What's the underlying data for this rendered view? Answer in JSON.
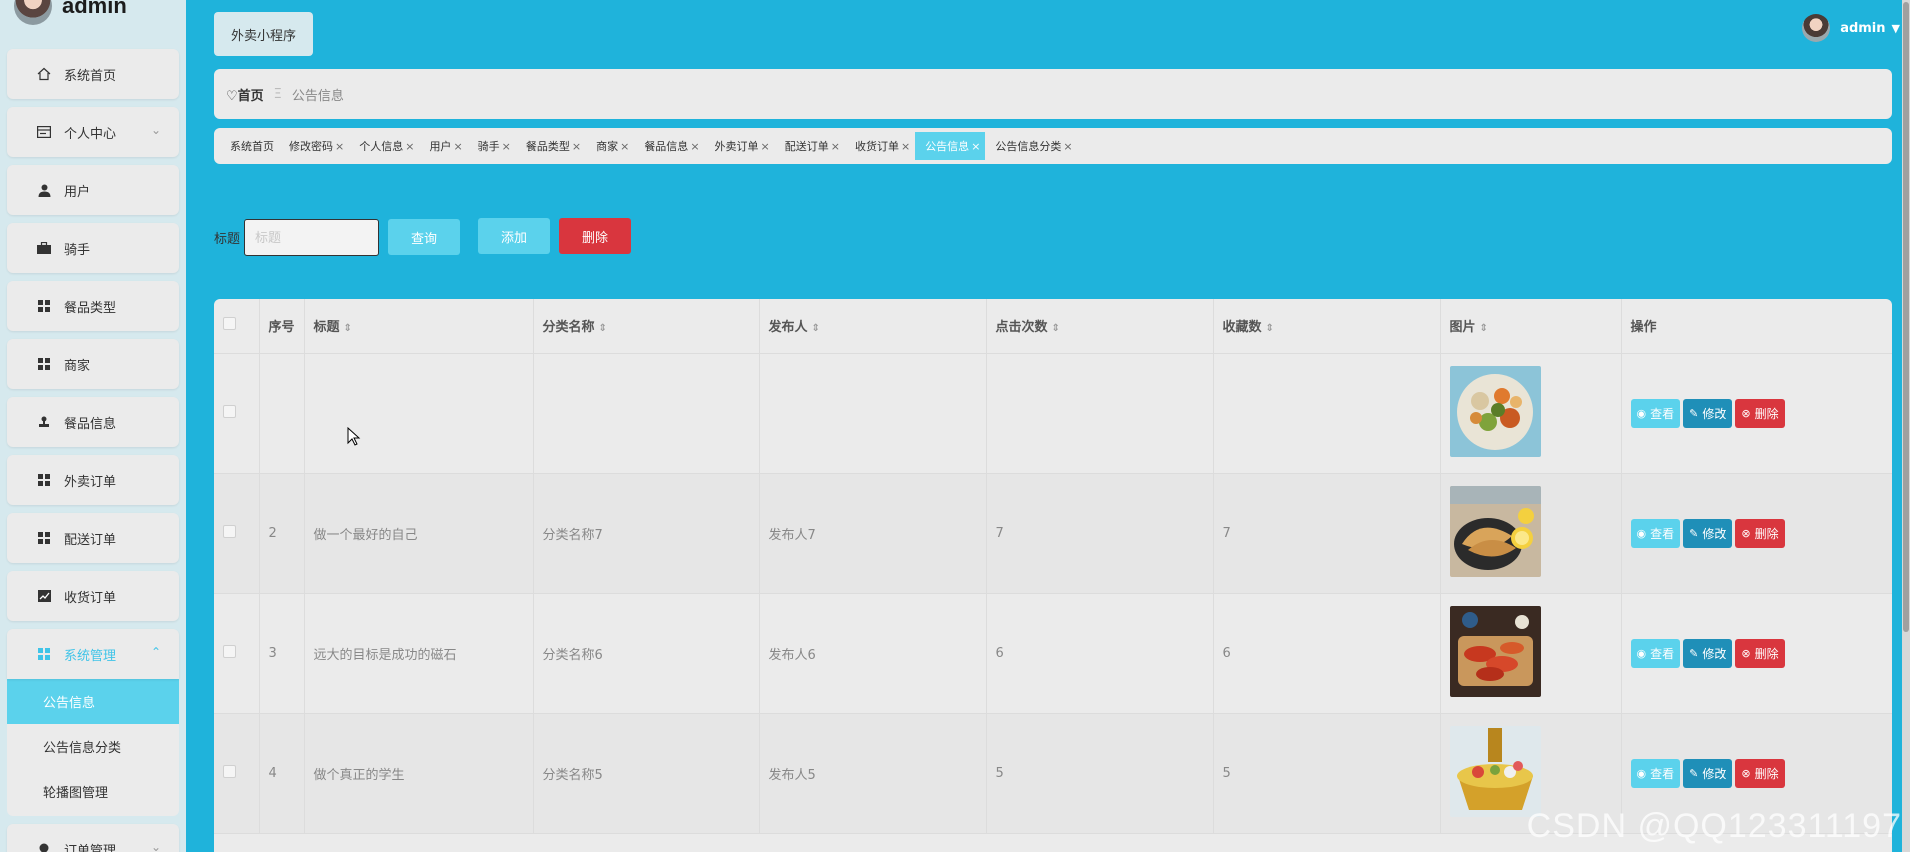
{
  "sidebar": {
    "username": "admin",
    "items": [
      {
        "label": "系统首页",
        "icon": "home-icon"
      },
      {
        "label": "个人中心",
        "icon": "id-card-icon"
      },
      {
        "label": "用户",
        "icon": "user-icon"
      },
      {
        "label": "骑手",
        "icon": "briefcase-icon"
      },
      {
        "label": "餐品类型",
        "icon": "grid-icon"
      },
      {
        "label": "商家",
        "icon": "grid-icon"
      },
      {
        "label": "餐品信息",
        "icon": "stamp-icon"
      },
      {
        "label": "外卖订单",
        "icon": "grid-icon"
      },
      {
        "label": "配送订单",
        "icon": "grid-icon"
      },
      {
        "label": "收货订单",
        "icon": "chart-icon"
      },
      {
        "label": "系统管理",
        "icon": "grid-icon"
      },
      {
        "label": "订单管理",
        "icon": "bulb-icon"
      }
    ],
    "submenu": [
      "公告信息",
      "公告信息分类",
      "轮播图管理"
    ]
  },
  "header": {
    "app_button": "外卖小程序",
    "user": "admin"
  },
  "breadcrumb": {
    "home": "首页",
    "separator": "Ξ",
    "current": "公告信息"
  },
  "tags": [
    "系统首页",
    "修改密码",
    "个人信息",
    "用户",
    "骑手",
    "餐品类型",
    "商家",
    "餐品信息",
    "外卖订单",
    "配送订单",
    "收货订单",
    "公告信息",
    "公告信息分类"
  ],
  "search": {
    "label": "标题",
    "placeholder": "标题",
    "query": "查询",
    "add": "添加",
    "delete": "删除"
  },
  "table": {
    "headers": [
      "序号",
      "标题",
      "分类名称",
      "发布人",
      "点击次数",
      "收藏数",
      "图片",
      "操作"
    ],
    "ops": {
      "view": "查看",
      "edit": "修改",
      "delete": "删除"
    },
    "rows": [
      {
        "index": "",
        "title": "",
        "category": "",
        "publisher": "",
        "clicks": "",
        "favorites": ""
      },
      {
        "index": "2",
        "title": "做一个最好的自己",
        "category": "分类名称7",
        "publisher": "发布人7",
        "clicks": "7",
        "favorites": "7"
      },
      {
        "index": "3",
        "title": "远大的目标是成功的磁石",
        "category": "分类名称6",
        "publisher": "发布人6",
        "clicks": "6",
        "favorites": "6"
      },
      {
        "index": "4",
        "title": "做个真正的学生",
        "category": "分类名称5",
        "publisher": "发布人5",
        "clicks": "5",
        "favorites": "5"
      }
    ]
  },
  "watermark": "CSDN @QQ123311197",
  "colors": {
    "accent": "#1fb3db",
    "light_accent": "#5bd2ec",
    "danger": "#d9363e",
    "edit": "#1f8fb8",
    "panel": "#ebebeb"
  }
}
